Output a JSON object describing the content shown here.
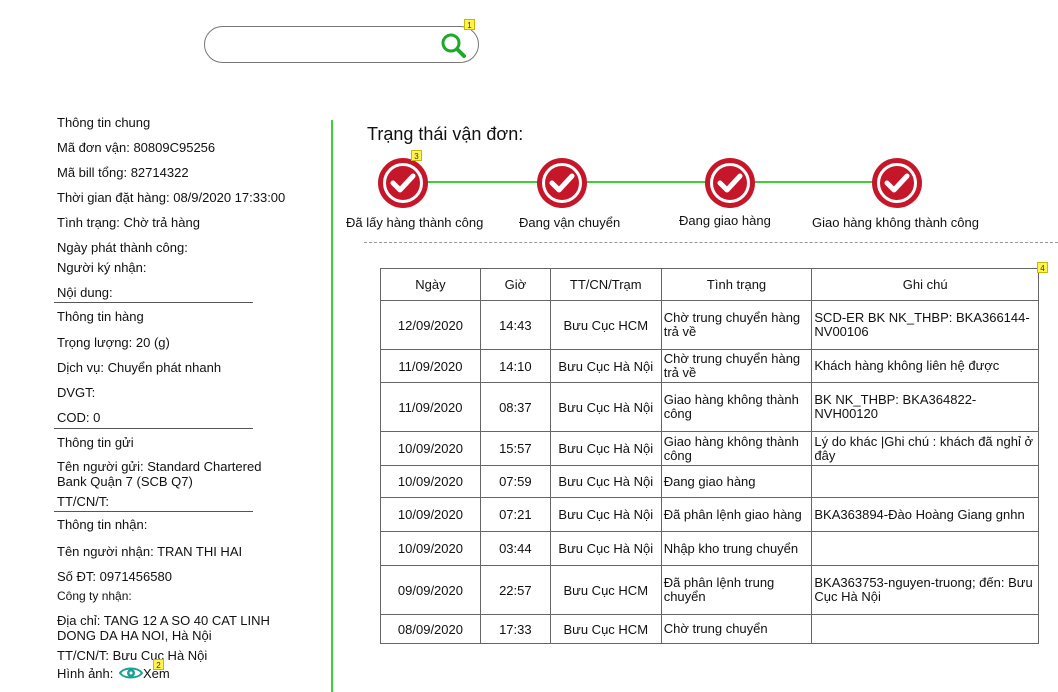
{
  "search": {
    "placeholder": "",
    "value": ""
  },
  "markers": [
    "1",
    "2",
    "3",
    "4"
  ],
  "general": {
    "title": "Thông tin chung",
    "order_code": "Mã đơn vận:  80809C95256",
    "bill_total": "Mã bill tổng: 82714322",
    "order_time": "Thời gian đặt hàng:  08/9/2020 17:33:00",
    "state": "Tình trạng: Chờ trả hàng",
    "issue_date": "Ngày phát thành công:",
    "receiver_signed": "Người ký nhận:",
    "content": "Nội dung:"
  },
  "goods": {
    "title": "Thông tin hàng",
    "weight": "Trọng lượng: 20 (g)",
    "service": "Dịch vụ: Chuyển phát nhanh",
    "dvgt": "DVGT:",
    "cod": "COD: 0"
  },
  "sender": {
    "title": "Thông tin gửi",
    "name_line1": "Tên người gửi: Standard Chartered",
    "name_line2": "Bank Quận 7 (SCB Q7)",
    "office": "TT/CN/T:"
  },
  "receiver": {
    "title": "Thông tin nhận:",
    "name": "Tên người nhận: TRAN THI HAI",
    "phone": "Số ĐT: 0971456580",
    "company": "Công ty nhận:",
    "address_line1": "Địa chỉ: TANG 12 A SO 40 CAT LINH",
    "address_line2": "DONG DA HA NOI, Hà Nội",
    "office": "TT/CN/T: Bưu Cục Hà Nội",
    "image_label": "Hình ảnh:",
    "view_label": "Xem"
  },
  "status": {
    "title": "Trạng thái vận đơn:",
    "steps": [
      "Đã lấy hàng thành công",
      "Đang vận chuyển",
      "Đang giao hàng",
      "Giao hàng không thành công"
    ],
    "color": "#c6172a",
    "line_color": "#3ccf3c"
  },
  "history": {
    "headers": [
      "Ngày",
      "Giờ",
      "TT/CN/Trạm",
      "Tình trạng",
      "Ghi chú"
    ],
    "rows": [
      [
        "12/09/2020",
        "14:43",
        "Bưu Cục HCM",
        "Chờ trung chuyển hàng trả về",
        "SCD-ER BK NK_THBP: BKA366144-NV00106"
      ],
      [
        "11/09/2020",
        "14:10",
        "Bưu Cục Hà Nội",
        "Chờ trung chuyển hàng trả về",
        "Khách hàng không liên hệ được"
      ],
      [
        "11/09/2020",
        "08:37",
        "Bưu Cục Hà Nội",
        "Giao hàng không thành công",
        "BK NK_THBP: BKA364822-NVH00120"
      ],
      [
        "10/09/2020",
        "15:57",
        "Bưu Cục Hà Nội",
        "Giao hàng không thành công",
        "Lý do khác |Ghi chú : khách đã nghỉ ở đây"
      ],
      [
        "10/09/2020",
        "07:59",
        "Bưu Cục Hà Nội",
        "Đang giao hàng",
        ""
      ],
      [
        "10/09/2020",
        "07:21",
        "Bưu Cục Hà Nội",
        "Đã phân lệnh giao hàng",
        "BKA363894-Đào Hoàng Giang gnhn"
      ],
      [
        "10/09/2020",
        "03:44",
        "Bưu Cục Hà Nội",
        "Nhập kho trung chuyển",
        ""
      ],
      [
        "09/09/2020",
        "22:57",
        "Bưu Cục HCM",
        "Đã phân lệnh trung chuyển",
        "BKA363753-nguyen-truong; đến: Bưu Cục Hà Nội"
      ],
      [
        "08/09/2020",
        "17:33",
        "Bưu Cục HCM",
        "Chờ trung chuyển",
        ""
      ]
    ]
  }
}
